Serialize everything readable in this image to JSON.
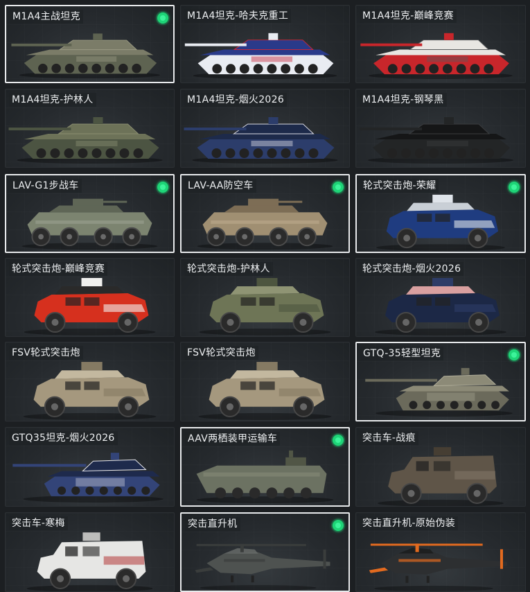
{
  "vehicles": [
    {
      "name": "M1A4主战坦克",
      "type": "tank",
      "colors": [
        "#7b7c68",
        "#5e6351",
        "#9a9a82"
      ],
      "selected": true,
      "equipped": true
    },
    {
      "name": "M1A4坦克-哈夫克重工",
      "type": "tank",
      "colors": [
        "#2a3a8a",
        "#e9ecf2",
        "#c8283a"
      ],
      "selected": false,
      "equipped": false
    },
    {
      "name": "M1A4坦克-巅峰竞赛",
      "type": "tank",
      "colors": [
        "#e8e6e2",
        "#c8262b",
        "#5a5c5e"
      ],
      "selected": false,
      "equipped": false
    },
    {
      "name": "M1A4坦克-护林人",
      "type": "tank",
      "colors": [
        "#6d7258",
        "#4c5442",
        "#8a8d70"
      ],
      "selected": false,
      "equipped": false
    },
    {
      "name": "M1A4坦克-烟火2026",
      "type": "tank",
      "colors": [
        "#1d2a4a",
        "#2c3d6b",
        "#d9d9e2"
      ],
      "selected": false,
      "equipped": false
    },
    {
      "name": "M1A4坦克-钢琴黑",
      "type": "tank",
      "colors": [
        "#151617",
        "#232526",
        "#3a3c3e"
      ],
      "selected": false,
      "equipped": false
    },
    {
      "name": "LAV-G1步战车",
      "type": "ifv8",
      "colors": [
        "#7c8470",
        "#5f6656",
        "#a0a696"
      ],
      "selected": true,
      "equipped": true
    },
    {
      "name": "LAV-AA防空车",
      "type": "ifv8",
      "colors": [
        "#a08f72",
        "#7d6d55",
        "#c1b091"
      ],
      "selected": true,
      "equipped": true
    },
    {
      "name": "轮式突击炮-荣耀",
      "type": "truck4",
      "colors": [
        "#1f3c80",
        "#dfe4ea",
        "#c9cfd6"
      ],
      "selected": true,
      "equipped": true
    },
    {
      "name": "轮式突击炮-巅峰竞赛",
      "type": "truck4",
      "colors": [
        "#d6301e",
        "#f0f0ee",
        "#2a2a2a"
      ],
      "selected": false,
      "equipped": false
    },
    {
      "name": "轮式突击炮-护林人",
      "type": "truck4",
      "colors": [
        "#6e7556",
        "#4d553f",
        "#8f9474"
      ],
      "selected": false,
      "equipped": false
    },
    {
      "name": "轮式突击炮-烟火2026",
      "type": "truck4",
      "colors": [
        "#1c2846",
        "#2d3c67",
        "#d9a0a0"
      ],
      "selected": false,
      "equipped": false
    },
    {
      "name": "FSV轮式突击炮",
      "type": "truck4",
      "colors": [
        "#a5987e",
        "#857a63",
        "#c3b89f"
      ],
      "selected": false,
      "equipped": false
    },
    {
      "name": "FSV轮式突击炮",
      "type": "truck4",
      "colors": [
        "#a5987e",
        "#857a63",
        "#c3b89f"
      ],
      "selected": false,
      "equipped": false
    },
    {
      "name": "GTQ-35轻型坦克",
      "type": "lighttank",
      "colors": [
        "#8c8a77",
        "#6b6a5b",
        "#b0ad99"
      ],
      "selected": true,
      "equipped": true
    },
    {
      "name": "GTQ35坦克-烟火2026",
      "type": "lighttank",
      "colors": [
        "#1e2a4c",
        "#334478",
        "#e8e8ee"
      ],
      "selected": false,
      "equipped": false
    },
    {
      "name": "AAV两栖装甲运输车",
      "type": "aav",
      "colors": [
        "#6c7262",
        "#515646",
        "#8d927f"
      ],
      "selected": true,
      "equipped": true
    },
    {
      "name": "突击车-战痕",
      "type": "mrap",
      "colors": [
        "#5f5548",
        "#463e33",
        "#84796a"
      ],
      "selected": false,
      "equipped": false
    },
    {
      "name": "突击车-寒梅",
      "type": "mrap",
      "colors": [
        "#e6e6e4",
        "#bdbdbb",
        "#b23636"
      ],
      "selected": false,
      "equipped": false
    },
    {
      "name": "突击直升机",
      "type": "heli",
      "colors": [
        "#4e5250",
        "#3a3d3c",
        "#6a6e6b"
      ],
      "selected": true,
      "equipped": true
    },
    {
      "name": "突击直升机-原始伪装",
      "type": "heli",
      "colors": [
        "#2d2f31",
        "#e26a1f",
        "#1a1b1c"
      ],
      "selected": false,
      "equipped": false
    }
  ]
}
